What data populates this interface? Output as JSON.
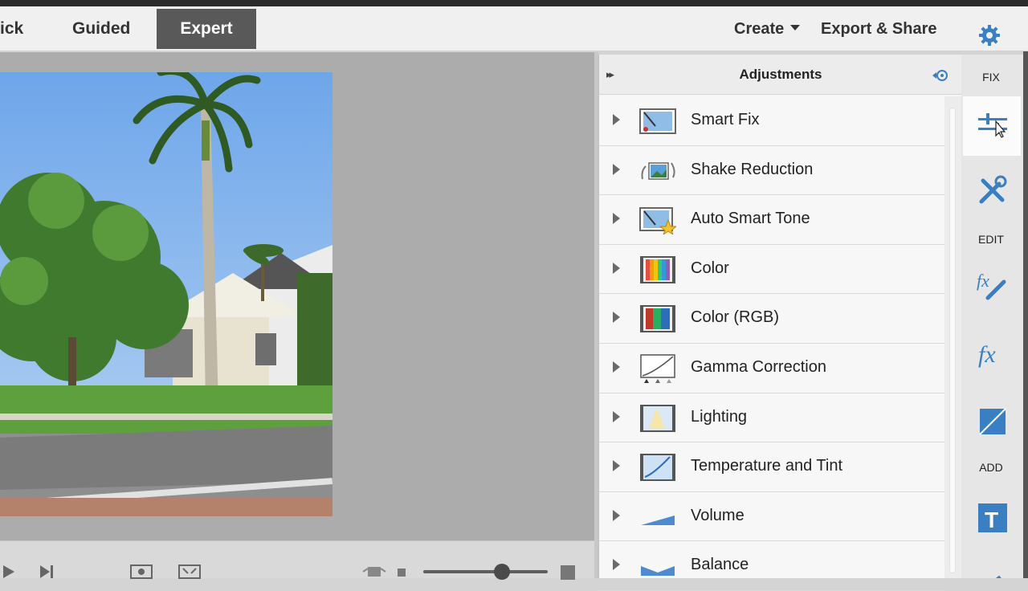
{
  "header": {
    "modes": [
      "ick",
      "Guided",
      "Expert"
    ],
    "active_mode": "Expert",
    "create_label": "Create",
    "export_label": "Export & Share",
    "settings_icon": "gear-icon"
  },
  "panel": {
    "title": "Adjustments",
    "collapse_glyph": "▸▸",
    "items": [
      {
        "label": "Smart Fix",
        "icon": "smart-fix-icon"
      },
      {
        "label": "Shake Reduction",
        "icon": "shake-reduction-icon"
      },
      {
        "label": "Auto Smart Tone",
        "icon": "auto-smart-tone-icon"
      },
      {
        "label": "Color",
        "icon": "color-icon"
      },
      {
        "label": "Color (RGB)",
        "icon": "color-rgb-icon"
      },
      {
        "label": "Gamma Correction",
        "icon": "gamma-correction-icon"
      },
      {
        "label": "Lighting",
        "icon": "lighting-icon"
      },
      {
        "label": "Temperature and Tint",
        "icon": "temperature-tint-icon"
      },
      {
        "label": "Volume",
        "icon": "volume-icon"
      },
      {
        "label": "Balance",
        "icon": "balance-icon"
      }
    ]
  },
  "rail": {
    "fix_label": "FIX",
    "edit_label": "EDIT",
    "add_label": "ADD"
  },
  "colors": {
    "accent": "#3a7fc1",
    "expert_bg": "#595959"
  }
}
